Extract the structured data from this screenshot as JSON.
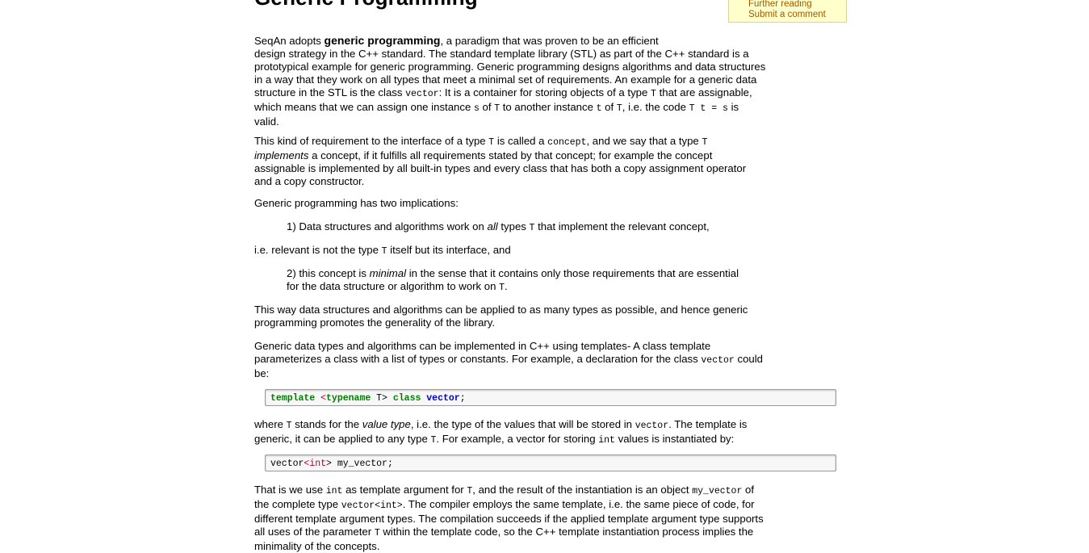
{
  "page": {
    "title": "Generic Programming",
    "toc_links": [
      "Further reading",
      "Submit a comment"
    ]
  },
  "paragraphs": {
    "p1": {
      "a": "SeqAn adopts ",
      "b": "generic programming",
      "c": ", a paradigm that was proven to be an efficient",
      "d": "design strategy in the C++ standard. The standard template library (STL) as part of the C++ standard is a",
      "e": "prototypical example for generic programming. Generic programming designs algorithms and data structures",
      "f": "in a way that they work on all types that meet a minimal set of requirements. An example for a generic data",
      "g1": "structure in the STL is the class ",
      "g2": "vector",
      "g3": ": It is a container for storing objects of a type ",
      "g4": "T",
      "g5": " that are assignable,",
      "h1": "which means that we can assign one instance ",
      "h2": "s",
      "h3": " of ",
      "h4": "T",
      "h5": " to another instance ",
      "h6": "t",
      "h7": " of ",
      "h8": "T",
      "h9": ", i.e. the code ",
      "h10": "T t = s",
      "h11": " is",
      "i": "valid."
    },
    "p2": {
      "a1": "This kind of requirement to the interface of a type ",
      "a2": "T",
      "a3": " is called a ",
      "a4": "concept",
      "a5": ", and we say that a type ",
      "a6": "T",
      "b1": "implements",
      "b2": " a concept, if it fulfills all requirements stated by that concept; for example the concept",
      "c": "assignable is implemented by all built-in types and every class that has both a copy assignment operator",
      "d": "and a copy constructor."
    },
    "p3": "Generic programming has two implications:",
    "p4": {
      "a": "1) Data structures and algorithms work on ",
      "b": "all",
      "c": " types ",
      "d": "T",
      "e": " that implement the relevant concept,"
    },
    "p5": {
      "a": "i.e. relevant is not the type ",
      "b": "T",
      "c": " itself but its interface, and"
    },
    "p6": {
      "a": "2) this concept is ",
      "b": "minimal",
      "c": " in the sense that it contains only those requirements that are essential",
      "d": "for the data structure or algorithm to work on ",
      "e": "T",
      "f": "."
    },
    "p7": {
      "a": "This way data structures and algorithms can be applied to as many types as possible, and hence generic",
      "b": "programming promotes the generality of the library."
    },
    "p8": {
      "a": "Generic data types and algorithms can be implemented in C++ using templates- A class template",
      "b1": "parameterizes a class with a list of types or constants. For example, a declaration for the class ",
      "b2": "vector",
      "b3": " could",
      "c": "be:"
    },
    "p9": {
      "a1": "where ",
      "a2": "T",
      "a3": " stands for the ",
      "a4": "value type",
      "a5": ", i.e. the type of the values that will be stored in ",
      "a6": "vector",
      "a7": ". The template is",
      "b1": "generic, it can be applied to any type ",
      "b2": "T",
      "b3": ". For example, a vector for storing ",
      "b4": "int",
      "b5": " values is instantiated by:"
    },
    "p10": {
      "a1": "That is we use ",
      "a2": "int",
      "a3": " as template argument for ",
      "a4": "T",
      "a5": ", and the result of the instantiation is an object ",
      "a6": "my_vector",
      "a7": " of",
      "b1": "the complete type ",
      "b2": "vector<int>",
      "b3": ". The compiler employs the same template, i.e. the same piece of code, for",
      "c": "different template argument types. The compilation succeeds if the applied template argument type supports",
      "d1": "all uses of the parameter ",
      "d2": "T",
      "d3": " within the template code, so the C++ template instantiation process implies the",
      "e": "minimality of the concepts."
    }
  },
  "code": {
    "c1": {
      "kw1": "template",
      "lt": " <",
      "kw2": "typename",
      "t": " T> ",
      "kw3": "class",
      "sp": " ",
      "name": "vector",
      "end": ";"
    },
    "c2": {
      "a": "vector",
      "lt": "<",
      "int": "int",
      "b": "> my_vector;"
    }
  }
}
